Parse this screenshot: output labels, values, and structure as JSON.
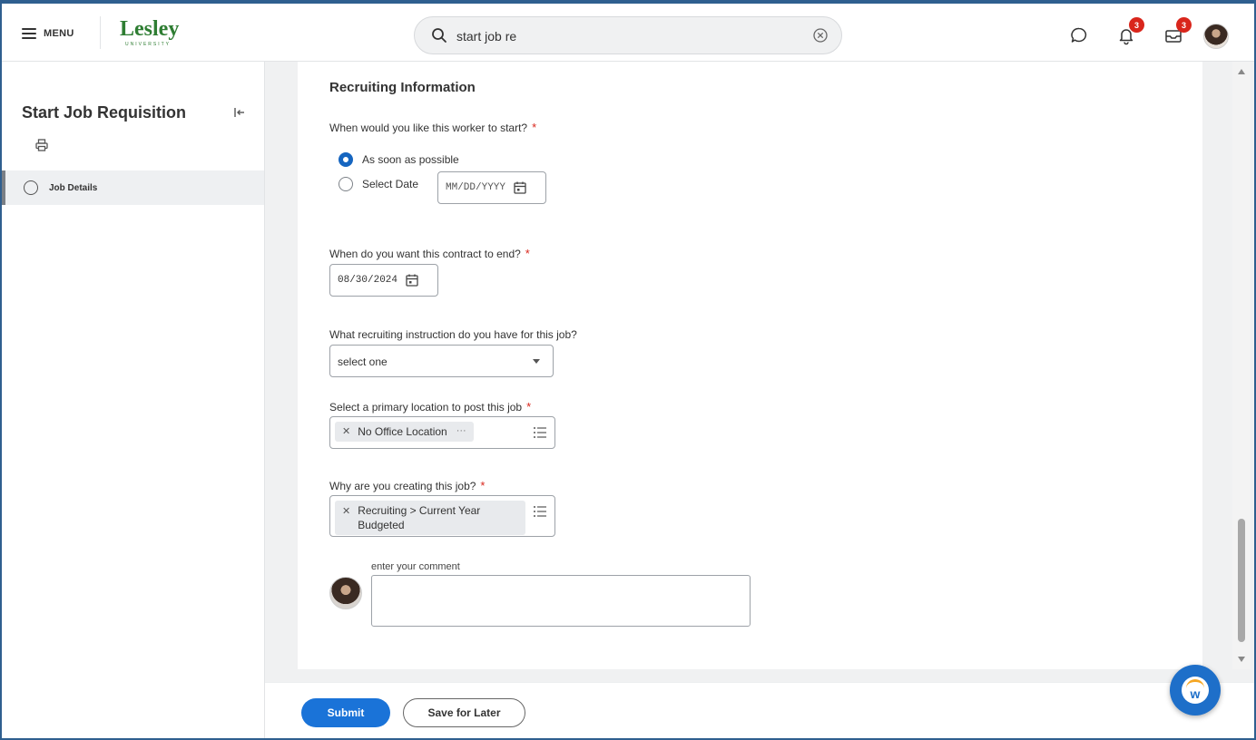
{
  "header": {
    "menu_label": "MENU",
    "logo_text": "Lesley",
    "logo_subtext": "UNIVERSITY",
    "search_value": "start job re",
    "notifications_count": "3",
    "inbox_count": "3",
    "icons": [
      "menu-icon",
      "search-icon",
      "clear-icon",
      "chat-icon",
      "bell-icon",
      "inbox-icon",
      "avatar"
    ]
  },
  "sidebar": {
    "task_title": "Start Job Requisition",
    "steps": [
      {
        "label": "Job Details"
      }
    ]
  },
  "form": {
    "section_title": "Recruiting Information",
    "start_question": "When would you like this worker to start?",
    "start_options": [
      {
        "label": "As soon as possible",
        "checked": true
      },
      {
        "label": "Select Date",
        "checked": false
      }
    ],
    "start_date_placeholder": "MM/DD/YYYY",
    "end_question": "When do you want this contract to end?",
    "end_date_value": "08/30/2024",
    "instruction_question": "What recruiting instruction do you have for this job?",
    "instruction_value": "select one",
    "location_question": "Select a primary location to post this job",
    "location_value": "No Office Location",
    "reason_question": "Why are you creating this job?",
    "reason_value_line1": "Recruiting > Current Year",
    "reason_value_line2": "Budgeted",
    "required_marker": "*",
    "comment_label": "enter your comment",
    "comment_value": ""
  },
  "footer": {
    "submit_label": "Submit",
    "save_label": "Save for Later"
  },
  "colors": {
    "accent": "#1a73d8",
    "required": "#d9261c",
    "brand": "#2e7d32"
  }
}
